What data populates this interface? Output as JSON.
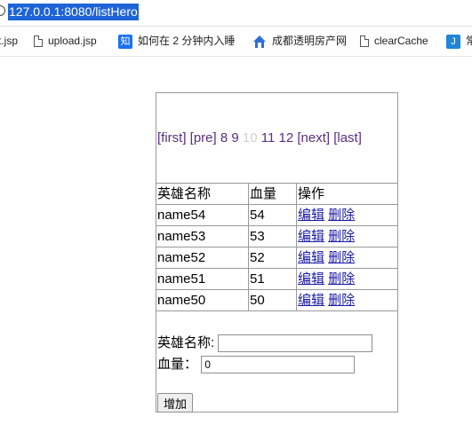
{
  "browser": {
    "url": "127.0.0.1:8080/listHero"
  },
  "bookmarks": [
    {
      "label": "t.jsp",
      "icon": "page-icon"
    },
    {
      "label": "upload.jsp",
      "icon": "page-icon"
    },
    {
      "label": "如何在 2 分钟内入睡",
      "icon": "zhihu-icon"
    },
    {
      "label": "成都透明房产网",
      "icon": "house-icon"
    },
    {
      "label": "clearCache",
      "icon": "page-icon"
    },
    {
      "label": "常",
      "icon": "j-icon"
    }
  ],
  "pager": {
    "first": "[first]",
    "pre": "[pre]",
    "pages": [
      "8",
      "9",
      "10",
      "11",
      "12"
    ],
    "current": "10",
    "next": "[next]",
    "last": "[last]"
  },
  "table": {
    "headers": [
      "英雄名称",
      "血量",
      "操作"
    ],
    "rows": [
      {
        "name": "name54",
        "hp": "54",
        "edit": "编辑",
        "delete": "删除"
      },
      {
        "name": "name53",
        "hp": "53",
        "edit": "编辑",
        "delete": "删除"
      },
      {
        "name": "name52",
        "hp": "52",
        "edit": "编辑",
        "delete": "删除"
      },
      {
        "name": "name51",
        "hp": "51",
        "edit": "编辑",
        "delete": "删除"
      },
      {
        "name": "name50",
        "hp": "50",
        "edit": "编辑",
        "delete": "删除"
      }
    ]
  },
  "form": {
    "name_label": "英雄名称:",
    "name_value": "",
    "hp_label": "血量：",
    "hp_value": "0",
    "submit_label": "增加"
  },
  "colors": {
    "url_highlight": "#1e64d6",
    "visited_link": "#5b2d83",
    "current_page": "#cfcfcf",
    "link": "#1a1aa6"
  }
}
